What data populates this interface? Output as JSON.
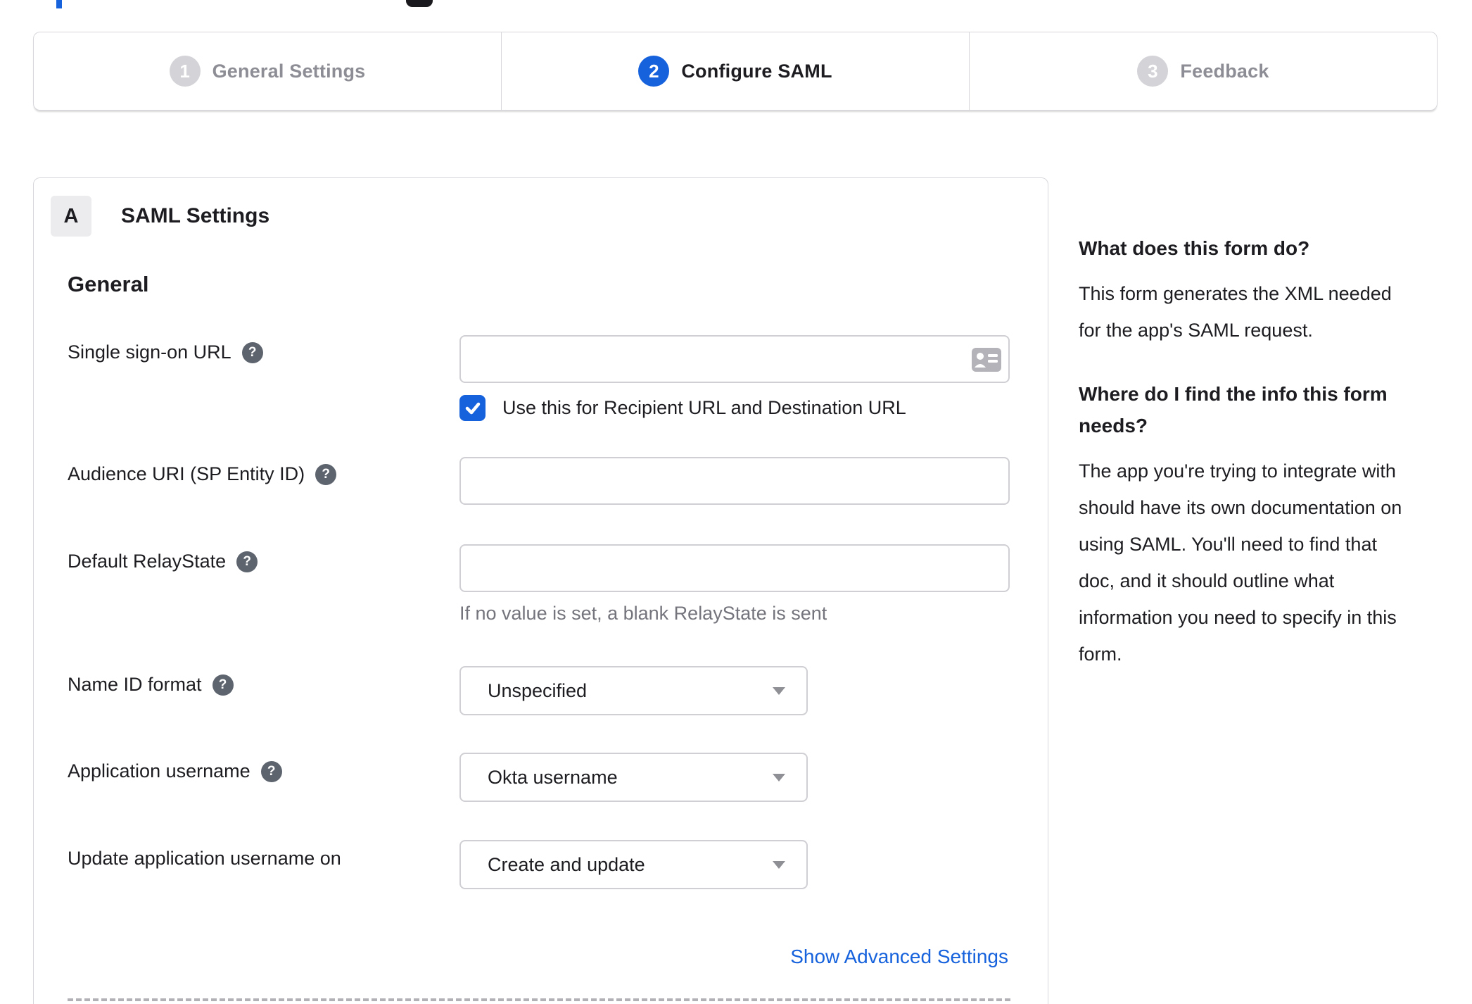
{
  "colors": {
    "accent_blue": "#1662dd",
    "text_dark": "#1d1d21",
    "muted_gray": "#8d8d95",
    "border_gray": "#d7d7dc",
    "help_icon_bg": "#5d646e"
  },
  "icons": {
    "help_glyph": "?"
  },
  "stepper": {
    "steps": [
      {
        "number": "1",
        "label": "General Settings",
        "state": "inactive"
      },
      {
        "number": "2",
        "label": "Configure SAML",
        "state": "active"
      },
      {
        "number": "3",
        "label": "Feedback",
        "state": "inactive"
      }
    ]
  },
  "panel": {
    "section_badge": "A",
    "section_title": "SAML Settings",
    "group_title": "General",
    "fields": {
      "sso_url": {
        "label": "Single sign-on URL",
        "value": "",
        "icon": "contact-card-icon"
      },
      "sso_checkbox": {
        "label": "Use this for Recipient URL and Destination URL",
        "checked": true
      },
      "audience_uri": {
        "label": "Audience URI (SP Entity ID)",
        "value": ""
      },
      "relay_state": {
        "label": "Default RelayState",
        "value": "",
        "helper": "If no value is set, a blank RelayState is sent"
      },
      "name_id_format": {
        "label": "Name ID format",
        "value": "Unspecified"
      },
      "app_username": {
        "label": "Application username",
        "value": "Okta username"
      },
      "update_app_username": {
        "label": "Update application username on",
        "value": "Create and update"
      }
    },
    "advanced_link": "Show Advanced Settings"
  },
  "sidebar": {
    "section1": {
      "title": "What does this form do?",
      "body_lines": [
        "This form generates the XML needed",
        "for the app's SAML request."
      ]
    },
    "section2": {
      "title_lines": [
        "Where do I find the info this form",
        "needs?"
      ],
      "body_lines": [
        "The app you're trying to integrate with",
        "should have its own documentation on",
        "using SAML. You'll need to find that",
        "doc, and it should outline what",
        "information you need to specify in this",
        "form."
      ]
    }
  }
}
